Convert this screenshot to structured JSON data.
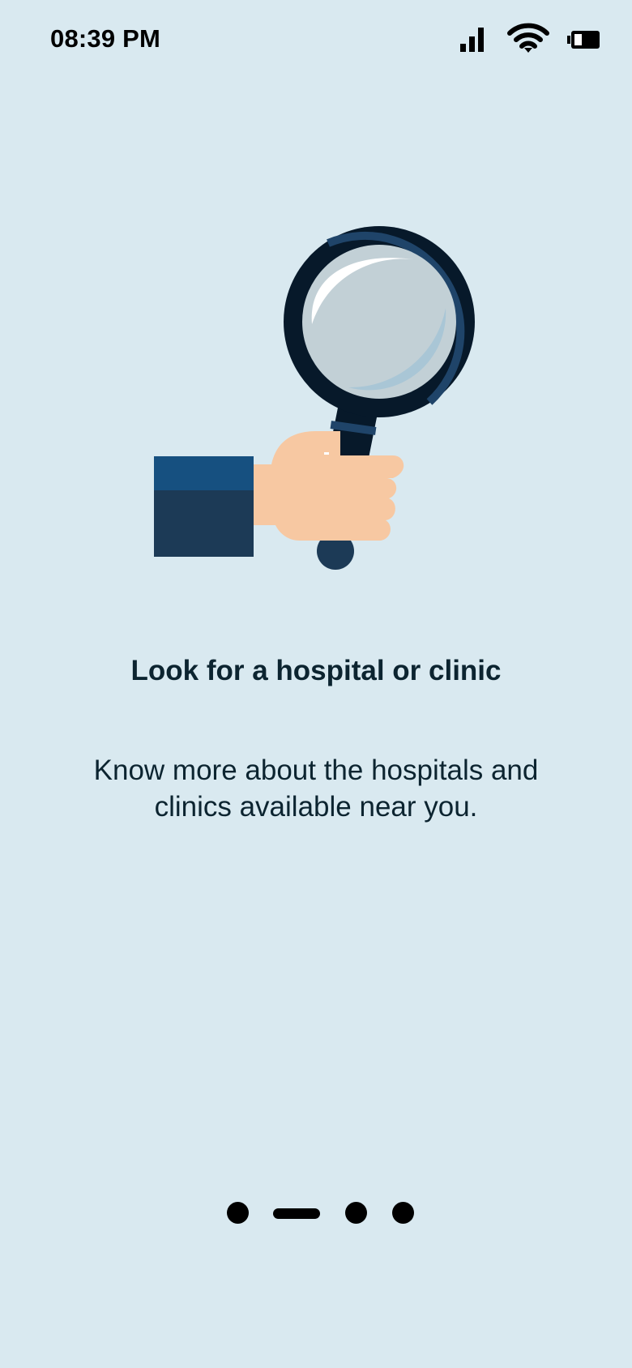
{
  "status_bar": {
    "time": "08:39 PM",
    "icons": [
      "signal-icon",
      "wifi-icon",
      "battery-icon"
    ]
  },
  "onboarding": {
    "illustration": "hand-holding-magnifying-glass",
    "title": "Look for a hospital or clinic",
    "description": "Know more about the hospitals and clinics available near you.",
    "pager": {
      "total_pages": 4,
      "active_index": 1
    }
  },
  "colors": {
    "background": "#d9e9f0",
    "text": "#0c2430",
    "indicator": "#000000"
  }
}
